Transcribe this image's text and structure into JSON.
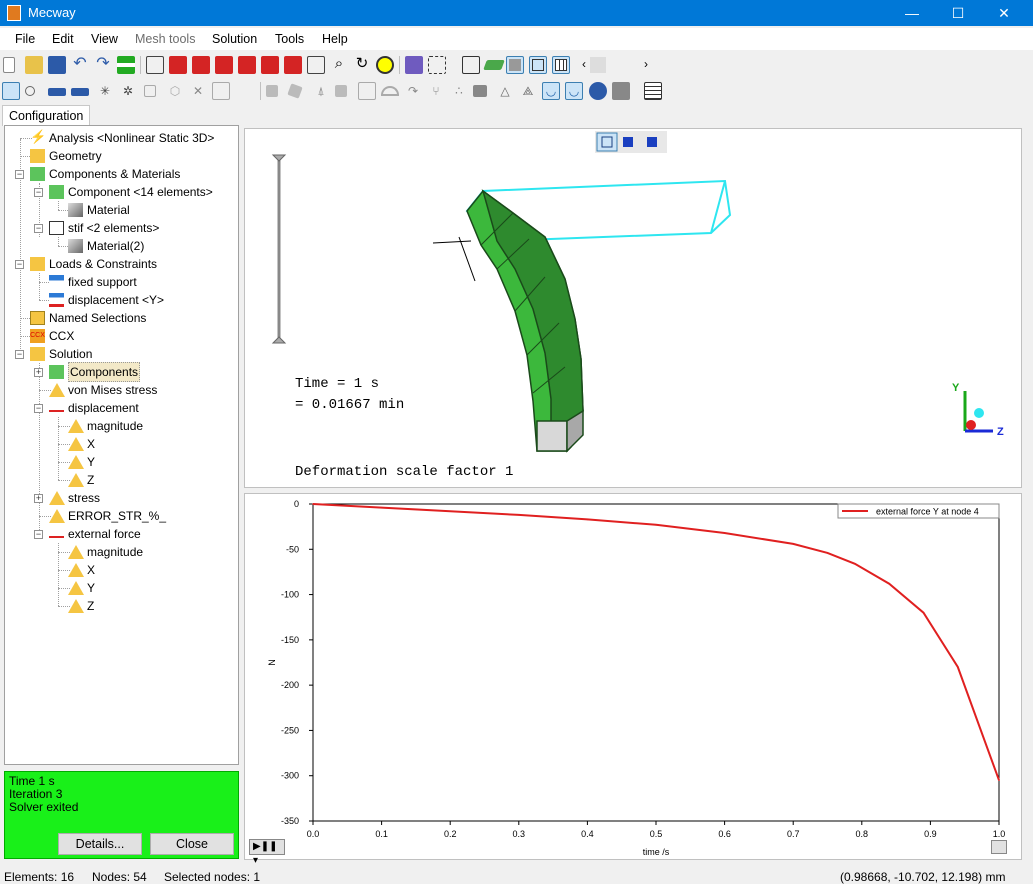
{
  "window": {
    "title": "Mecway",
    "minimize": "—",
    "maximize": "☐",
    "close": "✕"
  },
  "menu": [
    "File",
    "Edit",
    "View",
    "Mesh tools",
    "Solution",
    "Tools",
    "Help"
  ],
  "tab": "Configuration",
  "tree": [
    {
      "label": "Analysis <Nonlinear Static 3D>",
      "icon": "analysis-icon"
    },
    {
      "label": "Geometry",
      "icon": "folder-icon"
    },
    {
      "label": "Components & Materials",
      "icon": "components-icon"
    },
    {
      "label": "Component <14 elements>",
      "icon": "component-icon"
    },
    {
      "label": "Material",
      "icon": "material-icon"
    },
    {
      "label": "stif <2 elements>",
      "icon": "component-icon"
    },
    {
      "label": "Material(2)",
      "icon": "material-icon"
    },
    {
      "label": "Loads & Constraints",
      "icon": "loads-icon"
    },
    {
      "label": "fixed support",
      "icon": "fixed-support-icon"
    },
    {
      "label": "displacement <Y>",
      "icon": "displacement-constraint-icon"
    },
    {
      "label": "Named Selections",
      "icon": "named-selections-icon"
    },
    {
      "label": "CCX",
      "icon": "ccx-icon"
    },
    {
      "label": "Solution",
      "icon": "solution-icon"
    },
    {
      "label": "Components",
      "icon": "components-icon"
    },
    {
      "label": "von Mises stress",
      "icon": "result-icon"
    },
    {
      "label": "displacement",
      "icon": "vector-result-icon"
    },
    {
      "label": "magnitude",
      "icon": "result-icon"
    },
    {
      "label": "X",
      "icon": "result-icon"
    },
    {
      "label": "Y",
      "icon": "result-icon"
    },
    {
      "label": "Z",
      "icon": "result-icon"
    },
    {
      "label": "stress",
      "icon": "result-icon"
    },
    {
      "label": "ERROR_STR_%_",
      "icon": "result-icon"
    },
    {
      "label": "external force",
      "icon": "vector-result-icon"
    },
    {
      "label": "magnitude",
      "icon": "result-icon"
    },
    {
      "label": "X",
      "icon": "result-icon"
    },
    {
      "label": "Y",
      "icon": "result-icon"
    },
    {
      "label": "Z",
      "icon": "result-icon"
    }
  ],
  "solver_status": {
    "line1": "Time 1 s",
    "line2": "Iteration 3",
    "line3": "Solver exited",
    "details": "Details...",
    "close": "Close"
  },
  "view3d": {
    "time_line1": "Time = 1 s",
    "time_line2": "= 0.01667 min",
    "scale": "Deformation scale factor 1",
    "axis_y": "Y",
    "axis_z": "Z"
  },
  "statusbar": {
    "elements": "Elements: 16",
    "nodes": "Nodes: 54",
    "selected": "Selected nodes: 1",
    "coords": "(0.98668, -10.702, 12.198) mm"
  },
  "colors": {
    "titlebar": "#0078d7",
    "solver_panel": "#19f019",
    "series": "#e02020",
    "mesh_green": "#3cb83c",
    "outline_cyan": "#2ee6f0"
  },
  "chart_data": {
    "type": "line",
    "title": "",
    "xlabel": "time /s",
    "ylabel": "N",
    "xlim": [
      0,
      1
    ],
    "ylim": [
      -350,
      0
    ],
    "xticks": [
      "0.0",
      "0.1",
      "0.2",
      "0.3",
      "0.4",
      "0.5",
      "0.6",
      "0.7",
      "0.8",
      "0.9",
      "1.0"
    ],
    "yticks": [
      "0",
      "-50",
      "-100",
      "-150",
      "-200",
      "-250",
      "-300",
      "-350"
    ],
    "legend_position": "top-right",
    "series": [
      {
        "name": "external force Y at node 4",
        "color": "#e02020",
        "x": [
          0,
          0.1,
          0.2,
          0.3,
          0.4,
          0.5,
          0.6,
          0.7,
          0.75,
          0.79,
          0.84,
          0.89,
          0.94,
          1.0
        ],
        "y": [
          0,
          -4,
          -8,
          -12,
          -17,
          -23,
          -32,
          -44,
          -54,
          -66,
          -88,
          -120,
          -180,
          -305
        ]
      }
    ]
  }
}
